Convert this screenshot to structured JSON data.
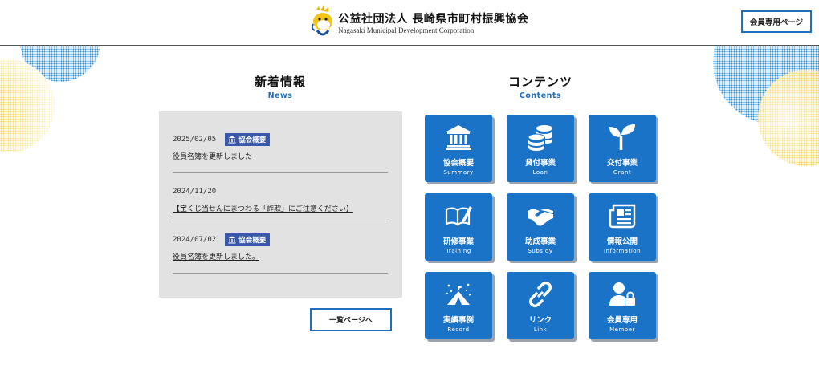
{
  "header": {
    "org_name": "公益社団法人 長崎県市町村振興協会",
    "org_name_en": "Nagasaki Municipal Development Corporation",
    "member_button": "会員専用ページ"
  },
  "news": {
    "title": "新着情報",
    "title_en": "News",
    "items": [
      {
        "date": "2025/02/05",
        "badge": "協会概要",
        "headline": "役員名簿を更新しました"
      },
      {
        "date": "2024/11/20",
        "badge": "",
        "headline": "【宝くじ当せんにまつわる「詐欺」にご注意ください】"
      },
      {
        "date": "2024/07/02",
        "badge": "協会概要",
        "headline": "役員名簿を更新しました。"
      }
    ],
    "list_button": "一覧ページへ"
  },
  "contents": {
    "title": "コンテンツ",
    "title_en": "Contents",
    "tiles": [
      {
        "label": "協会概要",
        "label_en": "Summary",
        "icon": "building-icon"
      },
      {
        "label": "貸付事業",
        "label_en": "Loan",
        "icon": "coins-icon"
      },
      {
        "label": "交付事業",
        "label_en": "Grant",
        "icon": "sprout-icon"
      },
      {
        "label": "研修事業",
        "label_en": "Training",
        "icon": "book-pen-icon"
      },
      {
        "label": "助成事業",
        "label_en": "Subsidy",
        "icon": "handshake-icon"
      },
      {
        "label": "情報公開",
        "label_en": "Information",
        "icon": "newspaper-icon"
      },
      {
        "label": "実績事例",
        "label_en": "Record",
        "icon": "tent-icon"
      },
      {
        "label": "リンク",
        "label_en": "Link",
        "icon": "link-icon"
      },
      {
        "label": "会員専用",
        "label_en": "Member",
        "icon": "user-lock-icon"
      }
    ]
  },
  "colors": {
    "accent_blue": "#1a73c7",
    "badge_blue": "#3a58a8",
    "news_bg": "#e2e2e2",
    "deco_yellow": "#f2c200",
    "deco_blue": "#2f8fd6"
  }
}
